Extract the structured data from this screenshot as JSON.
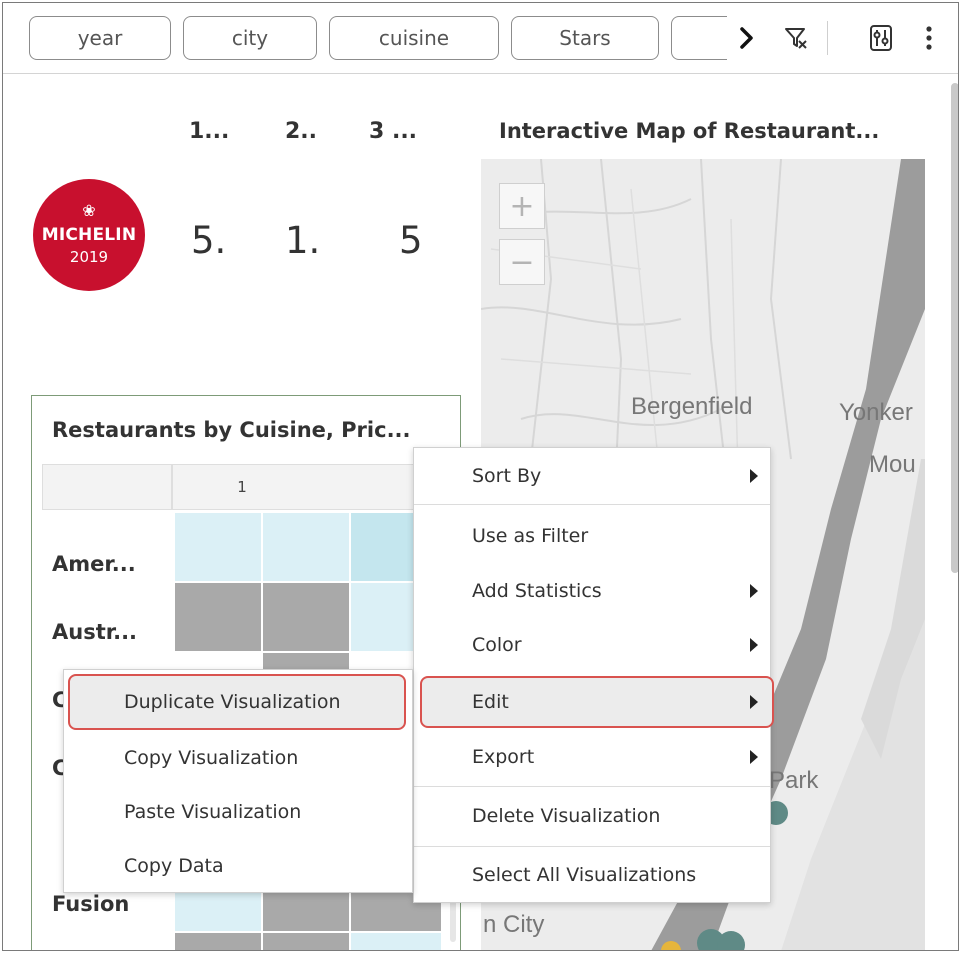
{
  "filter_bar": {
    "pills": [
      "year",
      "city",
      "cuisine",
      "Stars",
      ""
    ],
    "icons": [
      "chevron-right-icon",
      "filter-icon",
      "settings-sliders-icon",
      "more-vertical-icon"
    ]
  },
  "kpi": {
    "headers": [
      "1...",
      "2..",
      "3 ..."
    ],
    "values": [
      "5.",
      "1.",
      "5"
    ]
  },
  "logo": {
    "star": "❀",
    "brand": "MICHELIN",
    "year": "2019",
    "color": "#c8102e"
  },
  "heatmap": {
    "title": "Restaurants by Cuisine, Pric...",
    "column_header": "1",
    "rows": [
      "Amer...",
      "Austr...",
      "C",
      "C",
      "Fusion"
    ]
  },
  "map": {
    "title": "Interactive Map of Restaurant...",
    "zoom_in": "+",
    "zoom_out": "−",
    "places": [
      "Bergenfield",
      "Yonker",
      "Mou",
      "Park",
      "n City"
    ]
  },
  "context_menu": {
    "items": [
      "Sort By",
      "Use as Filter",
      "Add Statistics",
      "Color",
      "Edit",
      "Export",
      "Delete Visualization",
      "Select All Visualizations"
    ],
    "highlight_color": "#d9534f"
  },
  "submenu": {
    "items": [
      "Duplicate Visualization",
      "Copy Visualization",
      "Paste Visualization",
      "Copy Data"
    ]
  }
}
